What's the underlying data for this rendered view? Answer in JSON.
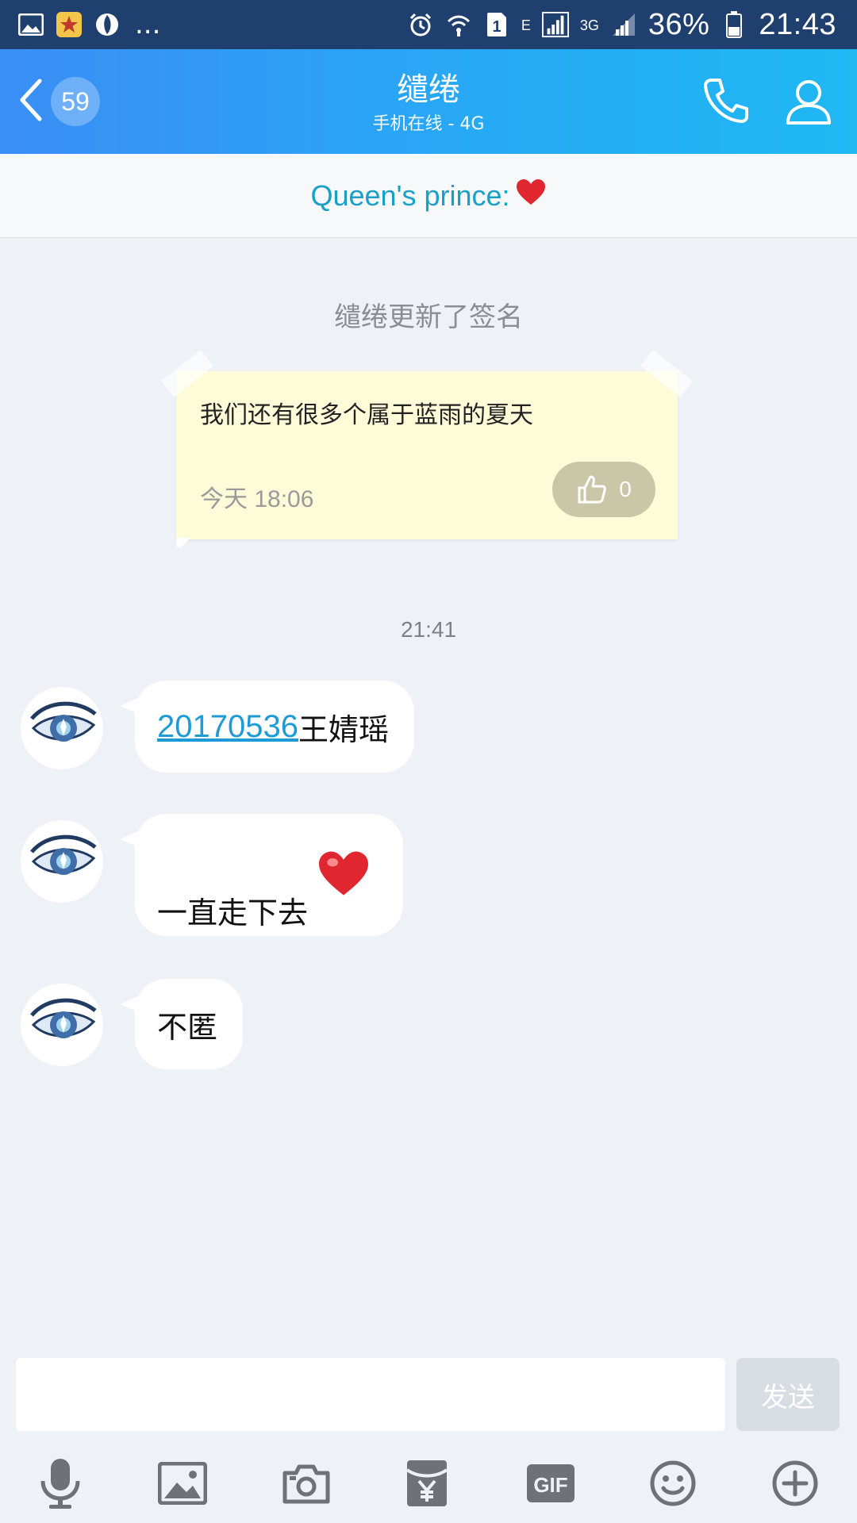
{
  "status_bar": {
    "dots": "...",
    "sim_slot": "1",
    "net_e": "E",
    "net_3g": "3G",
    "battery": "36%",
    "time": "21:43"
  },
  "header": {
    "unread_count": "59",
    "title": "缱绻",
    "subtitle": "手机在线 - 4G"
  },
  "signature_banner": {
    "text": "Queen's prince:",
    "emoji": "❤️"
  },
  "system_note": "缱绻更新了签名",
  "signature_card": {
    "text": "我们还有很多个属于蓝雨的夏天",
    "time": "今天 18:06",
    "likes": "0"
  },
  "time_separator": "21:41",
  "messages": [
    {
      "link": "20170536",
      "text": "王婧瑶"
    },
    {
      "text": "一直走下去",
      "emoji": "❤️"
    },
    {
      "text": "不匿"
    }
  ],
  "input": {
    "placeholder": "",
    "send_label": "发送"
  },
  "toolbar": {
    "gif_label": "GIF",
    "items": [
      "microphone-icon",
      "image-icon",
      "camera-icon",
      "red-packet-icon",
      "gif-icon",
      "emoji-icon",
      "plus-icon"
    ]
  },
  "colors": {
    "header_start": "#3a8ef5",
    "header_end": "#1fb8f3",
    "status_bar": "#1f3f6f",
    "chat_bg": "#eef1f6",
    "link": "#1e9bd7",
    "signature": "#1aa0c8",
    "note_card": "#fdfbd8"
  }
}
